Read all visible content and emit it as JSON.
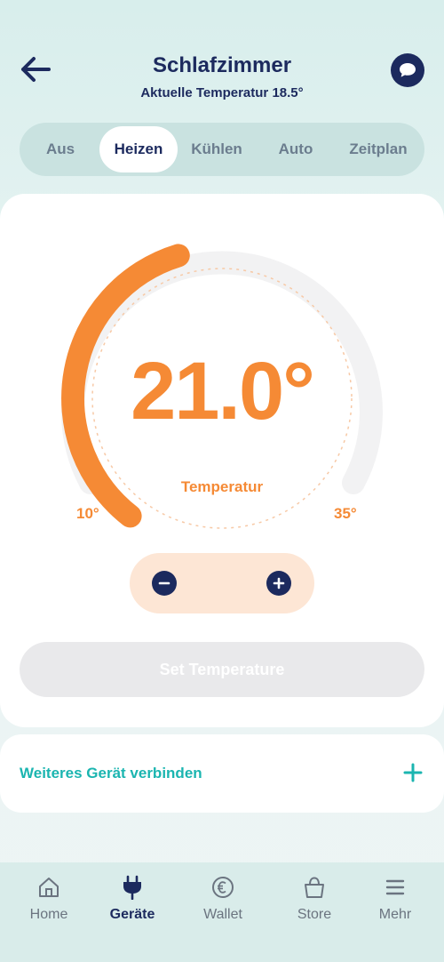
{
  "header": {
    "title": "Schlafzimmer",
    "subtitle": "Aktuelle Temperatur 18.5°",
    "back_icon": "arrow-left-icon",
    "chat_icon": "chat-bubble-icon"
  },
  "tabs": [
    {
      "label": "Aus",
      "active": false
    },
    {
      "label": "Heizen",
      "active": true
    },
    {
      "label": "Kühlen",
      "active": false
    },
    {
      "label": "Auto",
      "active": false
    },
    {
      "label": "Zeitplan",
      "active": false
    }
  ],
  "thermostat": {
    "target_temperature": "21.0°",
    "label": "Temperatur",
    "min_label": "10°",
    "max_label": "35°",
    "min": 10,
    "max": 35,
    "value": 21.0,
    "accent_color": "#f58a35"
  },
  "stepper": {
    "minus_icon": "minus-circle-icon",
    "plus_icon": "plus-circle-icon"
  },
  "set_button": {
    "label": "Set Temperature",
    "disabled": true
  },
  "connect": {
    "label": "Weiteres Gerät verbinden",
    "icon": "plus-icon",
    "color": "#1bb5b0"
  },
  "nav": {
    "items": [
      {
        "label": "Home",
        "icon": "home-icon",
        "active": false
      },
      {
        "label": "Geräte",
        "icon": "plug-icon",
        "active": true
      },
      {
        "label": "Wallet",
        "icon": "euro-coin-icon",
        "active": false
      },
      {
        "label": "Store",
        "icon": "shopping-bag-icon",
        "active": false
      },
      {
        "label": "Mehr",
        "icon": "menu-icon",
        "active": false
      }
    ]
  },
  "colors": {
    "primary": "#1c2a5e",
    "accent": "#f58a35",
    "teal": "#1bb5b0"
  }
}
